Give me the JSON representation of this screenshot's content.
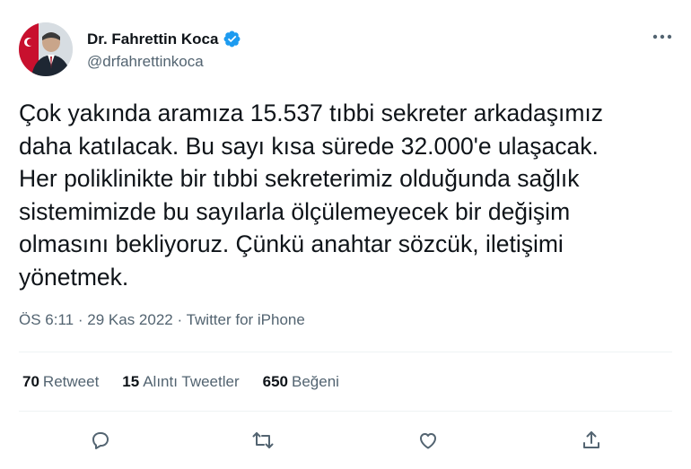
{
  "author": {
    "display_name": "Dr. Fahrettin Koca",
    "handle": "@drfahrettinkoca",
    "verified": true,
    "verified_color": "#1d9bf0"
  },
  "tweet": {
    "lines": [
      "Çok yakında aramıza 15.537 tıbbi sekreter arkadaşımız",
      "daha katılacak. Bu sayı kısa sürede 32.000'e ulaşacak.",
      "Her poliklinikte bir tıbbi sekreterimiz olduğunda sağlık",
      "sistemimizde bu sayılarla ölçülemeyecek bir değişim",
      "olmasını bekliyoruz. Çünkü anahtar sözcük, iletişimi",
      "yönetmek."
    ],
    "time": "ÖS 6:11",
    "date": "29 Kas 2022",
    "source": "Twitter for iPhone",
    "separator": "·"
  },
  "stats": [
    {
      "count": "70",
      "label": "Retweet"
    },
    {
      "count": "15",
      "label": "Alıntı Tweetler"
    },
    {
      "count": "650",
      "label": "Beğeni"
    }
  ],
  "icons": {
    "more": "more-horizontal-icon",
    "reply": "reply-icon",
    "retweet": "retweet-icon",
    "like": "heart-icon",
    "share": "share-icon"
  },
  "colors": {
    "text": "#0f1419",
    "secondary": "#536471",
    "divider": "#eff3f4"
  }
}
